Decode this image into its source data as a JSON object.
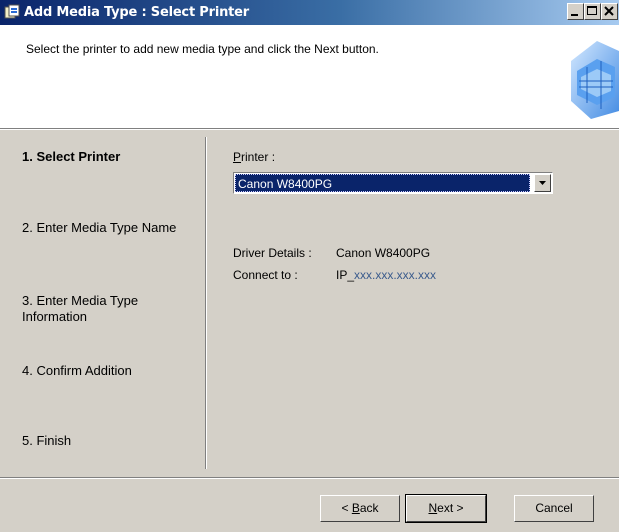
{
  "window": {
    "title": "Add Media Type : Select Printer"
  },
  "header": {
    "instruction": "Select the printer to add new media type and click  the Next button."
  },
  "steps": [
    {
      "label": "1.  Select Printer"
    },
    {
      "label": "2.  Enter Media Type Name"
    },
    {
      "label": "3.  Enter Media Type Information"
    },
    {
      "label": "4.  Confirm Addition"
    },
    {
      "label": "5.  Finish"
    }
  ],
  "active_step": 1,
  "form": {
    "printer_label_first": "P",
    "printer_label_rest": "rinter :",
    "printer_value": "Canon W8400PG",
    "driver_label": "Driver Details :",
    "driver_value": "Canon W8400PG",
    "connect_label": "Connect to :",
    "connect_prefix": "IP_",
    "connect_value": "xxx.xxx.xxx.xxx"
  },
  "buttons": {
    "back_lt": "< ",
    "back_mn": "B",
    "back_rest": "ack",
    "next_mn": "N",
    "next_rest": "ext >",
    "cancel": "Cancel"
  },
  "colors": {
    "title_gradient_start": "#0a246a",
    "title_gradient_end": "#a6caf0",
    "selection": "#0a246a",
    "link_blue": "#3a5b8c"
  }
}
